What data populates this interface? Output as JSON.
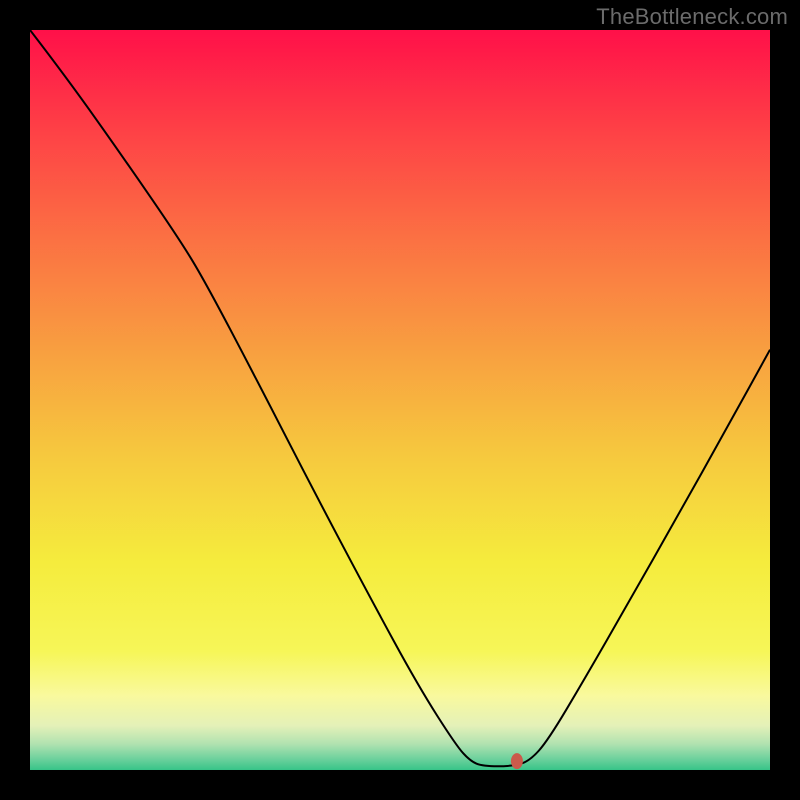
{
  "watermark": {
    "text": "TheBottleneck.com"
  },
  "chart_data": {
    "type": "line",
    "title": "",
    "xlabel": "",
    "ylabel": "",
    "xlim": [
      0,
      100
    ],
    "ylim": [
      0,
      100
    ],
    "grid": false,
    "background": {
      "type": "vertical-gradient",
      "stops": [
        {
          "pos": 0.0,
          "color": "#FF1049"
        },
        {
          "pos": 0.14,
          "color": "#FE4246"
        },
        {
          "pos": 0.28,
          "color": "#FB7043"
        },
        {
          "pos": 0.44,
          "color": "#F8A140"
        },
        {
          "pos": 0.58,
          "color": "#F6CA3E"
        },
        {
          "pos": 0.72,
          "color": "#F5EC3D"
        },
        {
          "pos": 0.84,
          "color": "#F6F658"
        },
        {
          "pos": 0.9,
          "color": "#F9F99E"
        },
        {
          "pos": 0.94,
          "color": "#E4F1B8"
        },
        {
          "pos": 0.965,
          "color": "#B0E2B0"
        },
        {
          "pos": 0.985,
          "color": "#6DD19D"
        },
        {
          "pos": 1.0,
          "color": "#37C488"
        }
      ]
    },
    "series": [
      {
        "name": "bottleneck-curve",
        "stroke": "#000000",
        "stroke_width": 2,
        "points": [
          {
            "x": 0.0,
            "y": 100.0
          },
          {
            "x": 5.0,
            "y": 93.5
          },
          {
            "x": 13.0,
            "y": 82.2
          },
          {
            "x": 20.0,
            "y": 72.0
          },
          {
            "x": 23.5,
            "y": 66.3
          },
          {
            "x": 30.5,
            "y": 53.0
          },
          {
            "x": 38.2,
            "y": 38.0
          },
          {
            "x": 45.8,
            "y": 23.6
          },
          {
            "x": 52.5,
            "y": 11.3
          },
          {
            "x": 57.6,
            "y": 3.3
          },
          {
            "x": 59.5,
            "y": 1.2
          },
          {
            "x": 61.2,
            "y": 0.5
          },
          {
            "x": 65.2,
            "y": 0.5
          },
          {
            "x": 67.5,
            "y": 1.2
          },
          {
            "x": 70.0,
            "y": 4.0
          },
          {
            "x": 75.0,
            "y": 12.4
          },
          {
            "x": 80.8,
            "y": 22.5
          },
          {
            "x": 87.5,
            "y": 34.3
          },
          {
            "x": 94.0,
            "y": 45.9
          },
          {
            "x": 100.0,
            "y": 56.8
          }
        ]
      }
    ],
    "marker": {
      "name": "optimal-point",
      "x": 65.8,
      "y": 1.2,
      "color": "#CB5A4B",
      "rx": 6,
      "ry": 8
    }
  }
}
